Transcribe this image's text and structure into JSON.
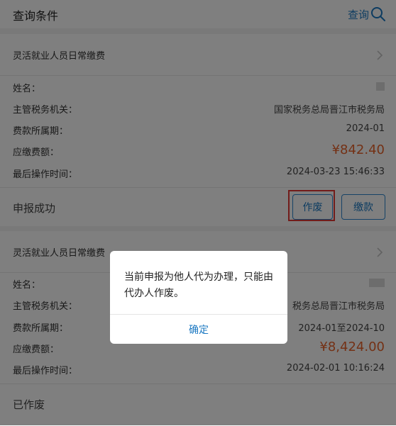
{
  "header": {
    "title": "查询条件",
    "search_label": "查询"
  },
  "records": [
    {
      "title": "灵活就业人员日常缴费",
      "fields": [
        {
          "label": "姓名：",
          "value": ""
        },
        {
          "label": "主管税务机关：",
          "value": "国家税务总局晋江市税务局"
        },
        {
          "label": "费款所属期：",
          "value": "2024-01"
        },
        {
          "label": "应缴费额：",
          "value": "¥842.40"
        },
        {
          "label": "最后操作时间：",
          "value": "2024-03-23 15:46:33"
        }
      ],
      "status": "申报成功",
      "actions": [
        "作废",
        "缴款"
      ]
    },
    {
      "title": "灵活就业人员日常缴费",
      "fields": [
        {
          "label": "姓名：",
          "value": ""
        },
        {
          "label": "主管税务机关：",
          "value": "税务总局晋江市税务局"
        },
        {
          "label": "费款所属期：",
          "value": "2024-01至2024-10"
        },
        {
          "label": "应缴费额：",
          "value": "¥8,424.00"
        },
        {
          "label": "最后操作时间：",
          "value": "2024-02-01 10:16:24"
        }
      ],
      "status": "已作废"
    }
  ],
  "dialog": {
    "message": "当前申报为他人代为办理，只能由代办人作废。",
    "confirm_label": "确定"
  },
  "colors": {
    "accent": "#1b78c2",
    "amount": "#e8622a",
    "highlight": "#e53935"
  },
  "icons": [
    "search-icon",
    "chevron-right-icon"
  ]
}
